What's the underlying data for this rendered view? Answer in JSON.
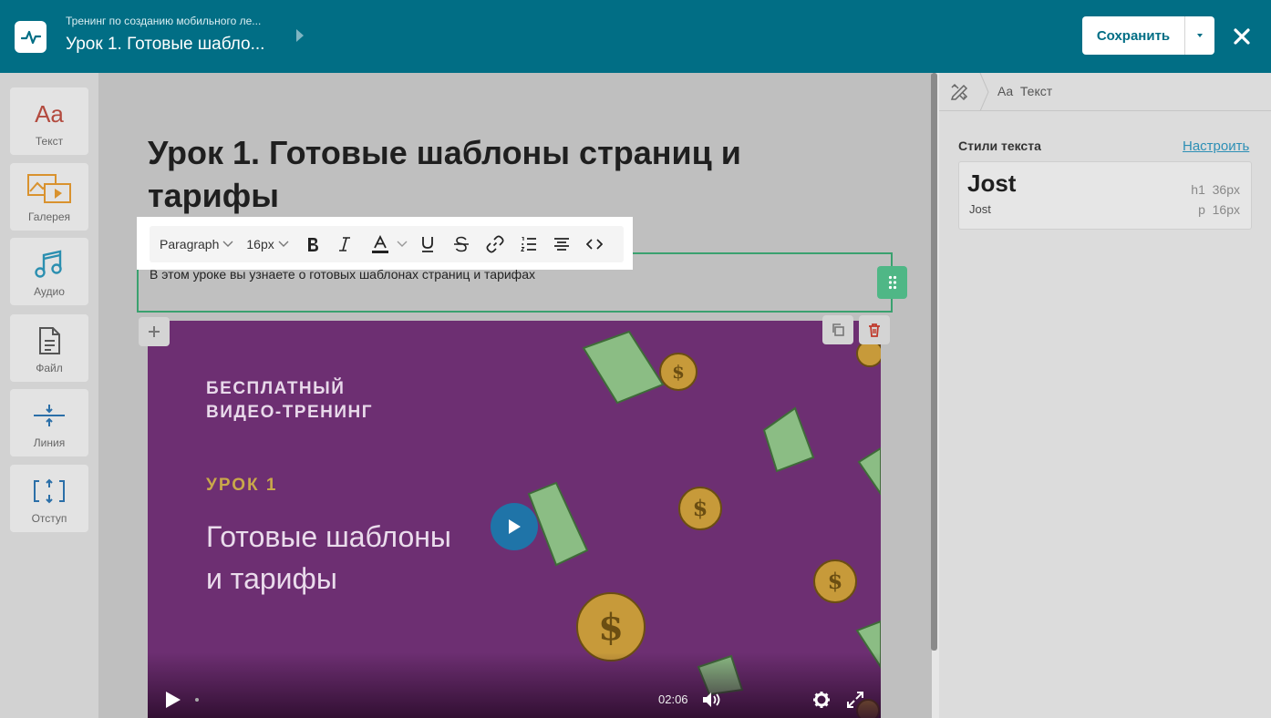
{
  "header": {
    "course_title": "Тренинг по созданию мобильного ле...",
    "lesson_title": "Урок 1. Готовые шабло...",
    "save_label": "Сохранить"
  },
  "tools": [
    {
      "label": "Текст",
      "icon": "text-icon"
    },
    {
      "label": "Галерея",
      "icon": "gallery-icon"
    },
    {
      "label": "Аудио",
      "icon": "audio-icon"
    },
    {
      "label": "Файл",
      "icon": "file-icon"
    },
    {
      "label": "Линия",
      "icon": "line-icon"
    },
    {
      "label": "Отступ",
      "icon": "spacing-icon"
    }
  ],
  "text_tool_glyph": "Aa",
  "editor": {
    "page_title": "Урок 1. Готовые шаблоны страниц и тарифы",
    "text_body": "В этом уроке вы узнаете о готовых шаблонах страниц и тарифах"
  },
  "format_toolbar": {
    "block_type": "Paragraph",
    "font_size": "16px",
    "buttons": [
      "bold",
      "italic",
      "text-color",
      "underline",
      "strikethrough",
      "link",
      "ordered-list",
      "align-center",
      "code"
    ]
  },
  "video": {
    "subtitle_line1": "БЕСПЛАТНЫЙ",
    "subtitle_line2": "ВИДЕО-ТРЕНИНГ",
    "lesson_label": "УРОК 1",
    "title_line1": "Готовые шаблоны",
    "title_line2": "и тарифы",
    "time": "02:06"
  },
  "right_panel": {
    "breadcrumb_glyph": "Aa",
    "breadcrumb_label": "Текст",
    "section_title": "Стили текста",
    "configure_label": "Настроить",
    "style_card": {
      "font_name": "Jost",
      "font_name_small": "Jost",
      "h1_tag": "h1",
      "h1_size": "36px",
      "p_tag": "p",
      "p_size": "16px"
    }
  },
  "colors": {
    "header_bg": "#016e85",
    "accent_green": "#3aa16f",
    "link_blue": "#2d8fb5",
    "video_bg": "#6d2f72"
  }
}
